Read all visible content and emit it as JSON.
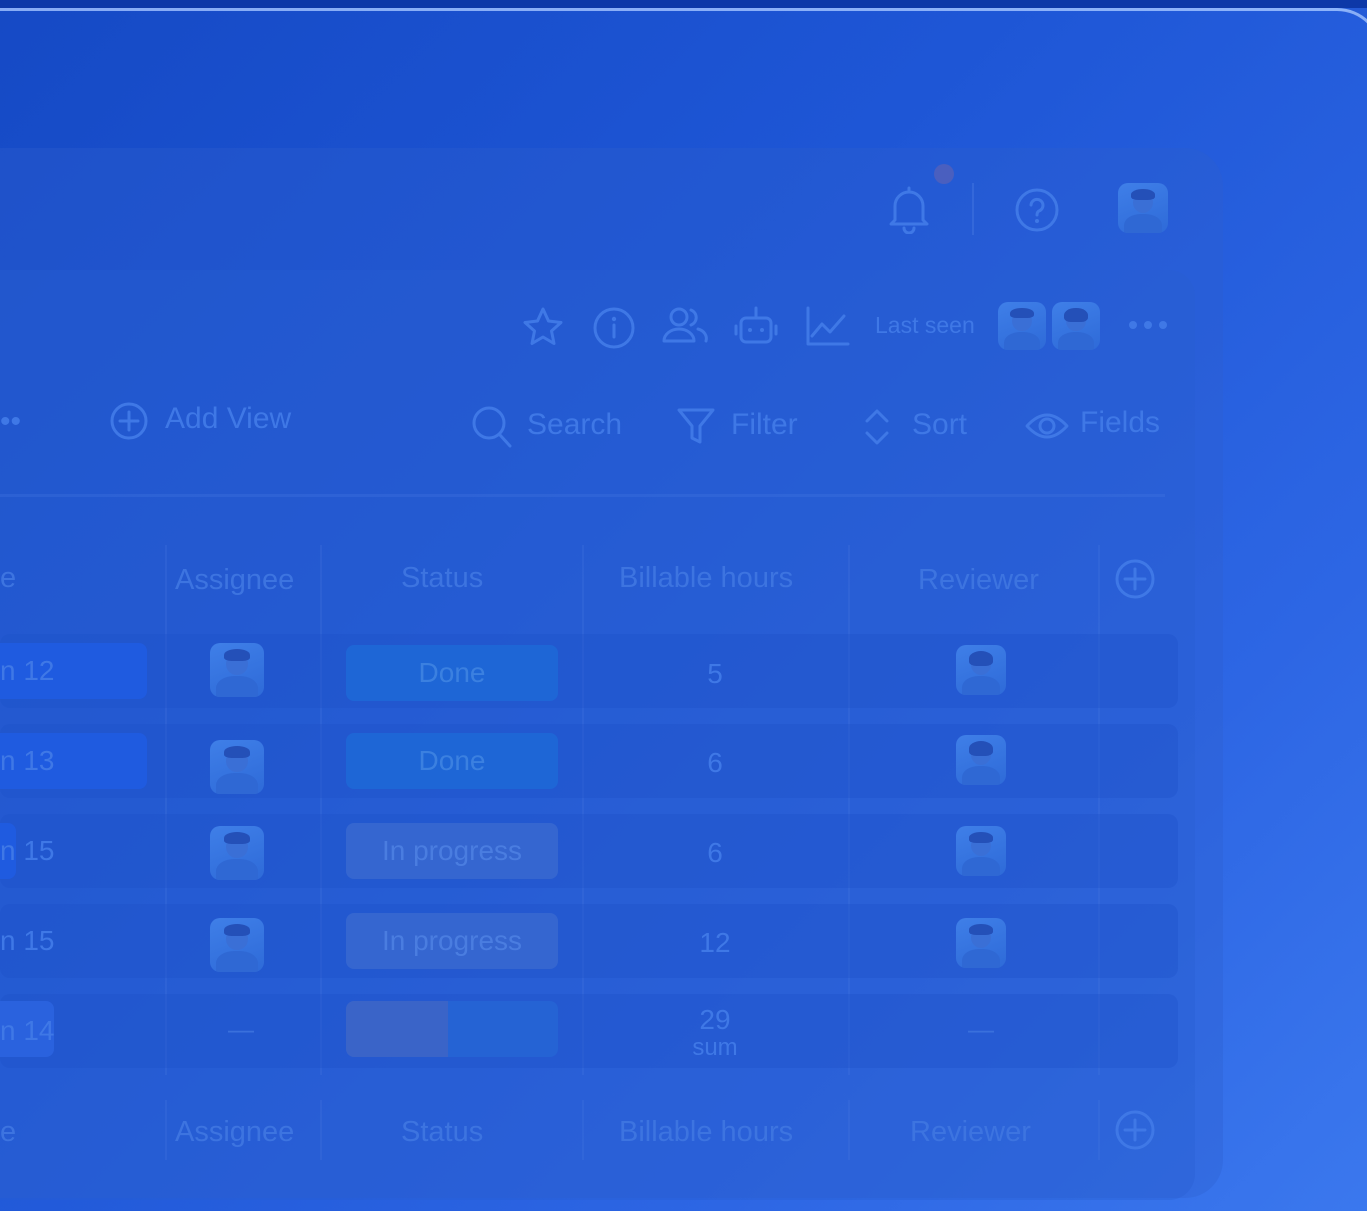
{
  "topbar": {
    "notifications_icon": "bell-icon",
    "help_icon": "help-circle-icon",
    "profile_icon": "user-avatar"
  },
  "board_header": {
    "last_seen_label": "Last seen",
    "icons": [
      "star-icon",
      "info-icon",
      "people-icon",
      "robot-icon",
      "chart-icon",
      "more-icon"
    ]
  },
  "toolbar": {
    "more_label": "••",
    "add_view_label": "Add View",
    "search_label": "Search",
    "filter_label": "Filter",
    "sort_label": "Sort",
    "fields_label": "Fields"
  },
  "table": {
    "columns": [
      "e",
      "Assignee",
      "Status",
      "Billable hours",
      "Reviewer"
    ],
    "rows": [
      {
        "name": "n 12",
        "status": "Done",
        "hours": "5"
      },
      {
        "name": "n 13",
        "status": "Done",
        "hours": "6"
      },
      {
        "name": "n 15",
        "status": "In progress",
        "hours": "6"
      },
      {
        "name": "n 15",
        "status": "In progress",
        "hours": "12"
      }
    ],
    "summary": {
      "name": "n 14",
      "assignee": "—",
      "hours": "29",
      "hours_label": "sum",
      "reviewer": "—",
      "status_done_fraction": 0.48
    },
    "footer_columns": [
      "e",
      "Assignee",
      "Status",
      "Billable hours",
      "Reviewer"
    ]
  },
  "colors": {
    "accent": "#3f78e6",
    "done": "#1e66d6",
    "in_progress": "#3566d0",
    "background": "#1e56d6"
  }
}
